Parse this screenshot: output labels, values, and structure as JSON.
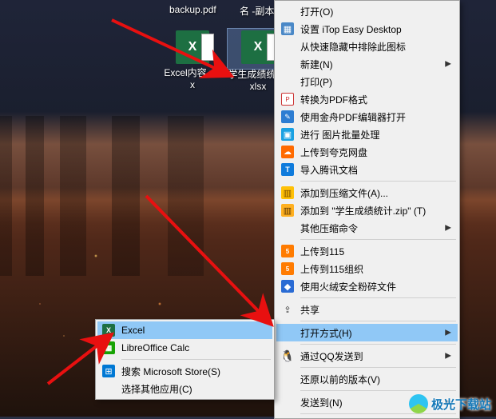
{
  "desktop": {
    "pdf_label": "backup.pdf",
    "sub_label": "名 -副本",
    "icons": [
      {
        "label": "Excel内容.xlsx",
        "glyph": "X"
      },
      {
        "label": "学生成绩统计.xlsx",
        "glyph": "X"
      }
    ]
  },
  "main_menu": {
    "items": [
      {
        "label": "打开(O)",
        "icon": null,
        "submenu": false
      },
      {
        "label": "设置 iTop Easy Desktop",
        "icon": "app",
        "submenu": false
      },
      {
        "label": "从快速隐藏中排除此图标",
        "icon": null,
        "submenu": false
      },
      {
        "label": "新建(N)",
        "icon": null,
        "submenu": true
      },
      {
        "label": "打印(P)",
        "icon": null,
        "submenu": false
      },
      {
        "label": "转换为PDF格式",
        "icon": "pdf",
        "submenu": false
      },
      {
        "label": "使用金舟PDF编辑器打开",
        "icon": "pdfedit",
        "submenu": false
      },
      {
        "label": "进行 图片批量处理",
        "icon": "img",
        "submenu": false
      },
      {
        "label": "上传到夸克网盘",
        "icon": "cloud",
        "submenu": false
      },
      {
        "label": "导入腾讯文档",
        "icon": "tencent",
        "submenu": false
      },
      {
        "sep": true
      },
      {
        "label": "添加到压缩文件(A)...",
        "icon": "zip",
        "submenu": false
      },
      {
        "label": "添加到 \"学生成绩统计.zip\" (T)",
        "icon": "zip2",
        "submenu": false
      },
      {
        "label": "其他压缩命令",
        "icon": null,
        "submenu": true
      },
      {
        "sep": true
      },
      {
        "label": "上传到115",
        "icon": "115",
        "submenu": false
      },
      {
        "label": "上传到115组织",
        "icon": "115",
        "submenu": false
      },
      {
        "label": "使用火绒安全粉碎文件",
        "icon": "fire",
        "submenu": false
      },
      {
        "sep": true
      },
      {
        "label": "共享",
        "icon": "share",
        "submenu": false
      },
      {
        "sep": true
      },
      {
        "label": "打开方式(H)",
        "icon": null,
        "submenu": true,
        "highlight": true
      },
      {
        "sep": true
      },
      {
        "label": "通过QQ发送到",
        "icon": "qq",
        "submenu": true
      },
      {
        "sep": true
      },
      {
        "label": "还原以前的版本(V)",
        "icon": null,
        "submenu": false
      },
      {
        "sep": true
      },
      {
        "label": "发送到(N)",
        "icon": null,
        "submenu": true
      },
      {
        "sep": true
      }
    ]
  },
  "sub_menu": {
    "items": [
      {
        "label": "Excel",
        "icon": "excel",
        "highlight": true
      },
      {
        "label": "LibreOffice Calc",
        "icon": "libre"
      },
      {
        "sep": true
      },
      {
        "label": "搜索 Microsoft Store(S)",
        "icon": "store"
      },
      {
        "label": "选择其他应用(C)",
        "icon": null
      }
    ]
  },
  "watermark": {
    "text": "极光下载站"
  },
  "colors": {
    "highlight": "#90c8f6",
    "arrow": "#e81010",
    "excel_green": "#1d6f42"
  }
}
